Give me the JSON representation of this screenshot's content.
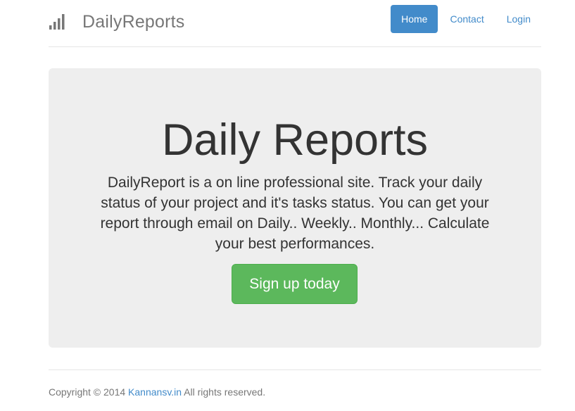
{
  "brand": {
    "name": "DailyReports",
    "icon": "signal-bars-icon"
  },
  "nav": {
    "items": [
      {
        "label": "Home",
        "active": true
      },
      {
        "label": "Contact",
        "active": false
      },
      {
        "label": "Login",
        "active": false
      }
    ]
  },
  "hero": {
    "title": "Daily Reports",
    "lead": "DailyReport is a on line professional site. Track your daily status of your project and it's tasks status. You can get your report through email on Daily.. Weekly.. Monthly... Calculate your best performances.",
    "cta_label": "Sign up today"
  },
  "footer": {
    "prefix": "Copyright © 2014 ",
    "link_text": "Kannansv.in",
    "suffix": " All rights reserved."
  },
  "colors": {
    "primary": "#428bca",
    "success": "#5cb85c",
    "jumbotron_bg": "#eeeeee",
    "muted_text": "#777777"
  }
}
